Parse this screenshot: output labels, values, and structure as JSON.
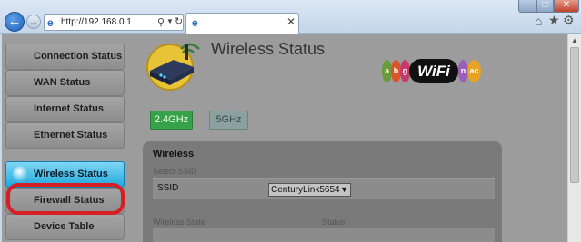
{
  "window": {
    "minimize_icon": "minimize-icon",
    "maximize_icon": "maximize-icon",
    "close_icon": "close-icon"
  },
  "browser": {
    "url": "http://192.168.0.1",
    "tab_title": "",
    "toolbar_icons": [
      "home-icon",
      "star-icon",
      "gear-icon"
    ]
  },
  "sidebar": {
    "items": [
      {
        "label": "Connection Status",
        "active": false
      },
      {
        "label": "WAN Status",
        "active": false
      },
      {
        "label": "Internet Status",
        "active": false
      },
      {
        "label": "Ethernet Status",
        "active": false
      },
      {
        "label": "Wireless Status",
        "active": true
      },
      {
        "label": "Firewall Status",
        "active": false
      },
      {
        "label": "Device Table",
        "active": false
      }
    ]
  },
  "header": {
    "title": "Wireless Status",
    "logo_prefix": [
      "a",
      "b",
      "g"
    ],
    "logo_text": "WiFi",
    "logo_suffix": [
      "n",
      "ac"
    ]
  },
  "bands": {
    "primary": "2.4GHz",
    "secondary": "5GHz"
  },
  "panel": {
    "title": "Wireless",
    "select_ssid_label": "Select SSID",
    "ssid_label": "SSID",
    "ssid_value": "CenturyLink5654",
    "columns": [
      "Wireless State",
      "Status"
    ]
  },
  "colors": {
    "active_nav": "#20a8dc",
    "highlight_ring": "#d61f25",
    "band_active": "#37a24a",
    "band_inactive": "#8aa1a0"
  }
}
